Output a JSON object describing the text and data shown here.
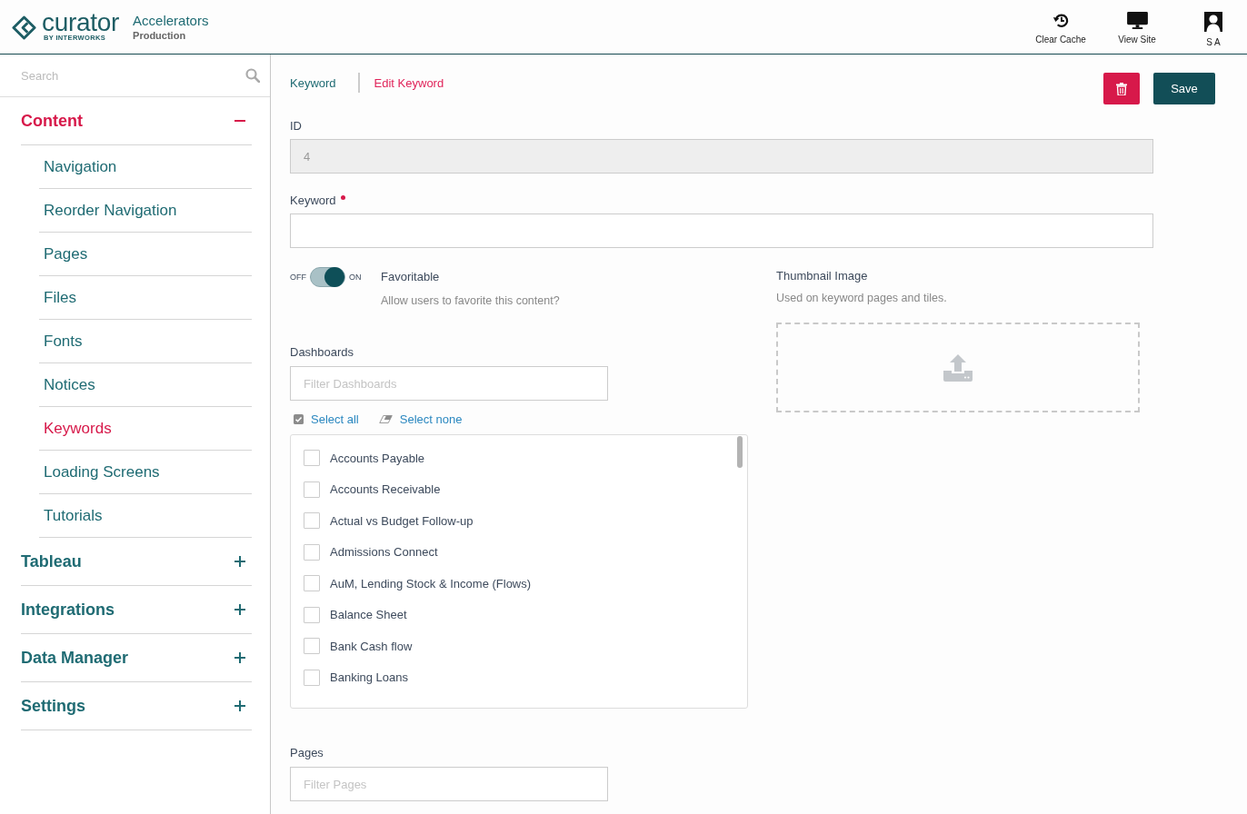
{
  "header": {
    "logo": {
      "wordmark": "curator",
      "tagline": "BY INTERWORKS"
    },
    "site_name": "Accelerators",
    "environment": "Production",
    "actions": [
      {
        "kind": "cache",
        "label": "Clear Cache"
      },
      {
        "kind": "monitor",
        "label": "View Site"
      },
      {
        "kind": "user",
        "label": "S A"
      }
    ]
  },
  "sidebar": {
    "search": {
      "placeholder": "Search"
    },
    "sections": [
      {
        "label": "Content",
        "selected": true,
        "expanded": true,
        "children": [
          {
            "label": "Navigation",
            "selected": false
          },
          {
            "label": "Reorder Navigation",
            "selected": false
          },
          {
            "label": "Pages",
            "selected": false
          },
          {
            "label": "Files",
            "selected": false
          },
          {
            "label": "Fonts",
            "selected": false
          },
          {
            "label": "Notices",
            "selected": false
          },
          {
            "label": "Keywords",
            "selected": true
          },
          {
            "label": "Loading Screens",
            "selected": false
          },
          {
            "label": "Tutorials",
            "selected": false
          }
        ]
      },
      {
        "label": "Tableau",
        "selected": false,
        "expanded": false
      },
      {
        "label": "Integrations",
        "selected": false,
        "expanded": false
      },
      {
        "label": "Data Manager",
        "selected": false,
        "expanded": false
      },
      {
        "label": "Settings",
        "selected": false,
        "expanded": false
      }
    ]
  },
  "main": {
    "breadcrumb": [
      {
        "label": "Keyword",
        "selected": false
      },
      {
        "label": "Edit Keyword",
        "selected": true
      }
    ],
    "buttons": [
      {
        "kind": "delete"
      },
      {
        "kind": "save",
        "label": "Save"
      }
    ],
    "fields": [
      {
        "label": "ID",
        "value": "4",
        "disabled": true,
        "required": false
      },
      {
        "label": "Keyword",
        "disabled": false,
        "required": true
      }
    ],
    "favoritable": {
      "off_label": "OFF",
      "on_label": "ON",
      "on": true,
      "label": "Favoritable",
      "description": "Allow users to favorite this content?"
    },
    "thumbnail": {
      "label": "Thumbnail Image",
      "description": "Used on keyword pages and tiles."
    },
    "dashboards": {
      "label": "Dashboards",
      "filter": {
        "placeholder": "Filter Dashboards"
      },
      "select_all": "Select all",
      "select_none": "Select none",
      "items": [
        {
          "label": "Accounts Payable",
          "checked": false
        },
        {
          "label": "Accounts Receivable",
          "checked": false
        },
        {
          "label": "Actual vs Budget Follow-up",
          "checked": false
        },
        {
          "label": "Admissions Connect",
          "checked": false
        },
        {
          "label": "AuM, Lending Stock & Income (Flows)",
          "checked": false
        },
        {
          "label": "Balance Sheet",
          "checked": false
        },
        {
          "label": "Bank Cash flow",
          "checked": false
        },
        {
          "label": "Banking Loans",
          "checked": false
        }
      ]
    },
    "pages": {
      "label": "Pages",
      "filter": {
        "placeholder": "Filter Pages"
      }
    }
  }
}
